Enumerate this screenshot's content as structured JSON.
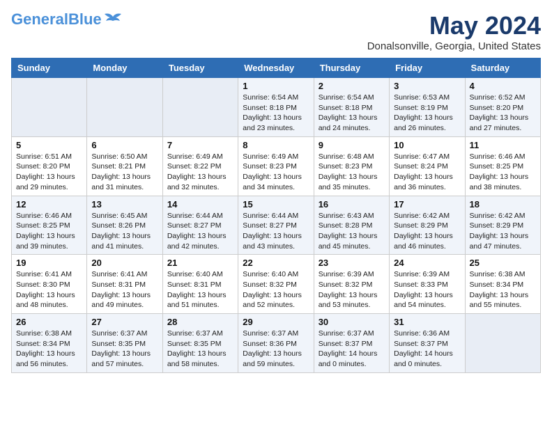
{
  "header": {
    "logo_line1": "General",
    "logo_line2": "Blue",
    "month": "May 2024",
    "location": "Donalsonville, Georgia, United States"
  },
  "weekdays": [
    "Sunday",
    "Monday",
    "Tuesday",
    "Wednesday",
    "Thursday",
    "Friday",
    "Saturday"
  ],
  "weeks": [
    [
      {
        "day": "",
        "info": ""
      },
      {
        "day": "",
        "info": ""
      },
      {
        "day": "",
        "info": ""
      },
      {
        "day": "1",
        "info": "Sunrise: 6:54 AM\nSunset: 8:18 PM\nDaylight: 13 hours\nand 23 minutes."
      },
      {
        "day": "2",
        "info": "Sunrise: 6:54 AM\nSunset: 8:18 PM\nDaylight: 13 hours\nand 24 minutes."
      },
      {
        "day": "3",
        "info": "Sunrise: 6:53 AM\nSunset: 8:19 PM\nDaylight: 13 hours\nand 26 minutes."
      },
      {
        "day": "4",
        "info": "Sunrise: 6:52 AM\nSunset: 8:20 PM\nDaylight: 13 hours\nand 27 minutes."
      }
    ],
    [
      {
        "day": "5",
        "info": "Sunrise: 6:51 AM\nSunset: 8:20 PM\nDaylight: 13 hours\nand 29 minutes."
      },
      {
        "day": "6",
        "info": "Sunrise: 6:50 AM\nSunset: 8:21 PM\nDaylight: 13 hours\nand 31 minutes."
      },
      {
        "day": "7",
        "info": "Sunrise: 6:49 AM\nSunset: 8:22 PM\nDaylight: 13 hours\nand 32 minutes."
      },
      {
        "day": "8",
        "info": "Sunrise: 6:49 AM\nSunset: 8:23 PM\nDaylight: 13 hours\nand 34 minutes."
      },
      {
        "day": "9",
        "info": "Sunrise: 6:48 AM\nSunset: 8:23 PM\nDaylight: 13 hours\nand 35 minutes."
      },
      {
        "day": "10",
        "info": "Sunrise: 6:47 AM\nSunset: 8:24 PM\nDaylight: 13 hours\nand 36 minutes."
      },
      {
        "day": "11",
        "info": "Sunrise: 6:46 AM\nSunset: 8:25 PM\nDaylight: 13 hours\nand 38 minutes."
      }
    ],
    [
      {
        "day": "12",
        "info": "Sunrise: 6:46 AM\nSunset: 8:25 PM\nDaylight: 13 hours\nand 39 minutes."
      },
      {
        "day": "13",
        "info": "Sunrise: 6:45 AM\nSunset: 8:26 PM\nDaylight: 13 hours\nand 41 minutes."
      },
      {
        "day": "14",
        "info": "Sunrise: 6:44 AM\nSunset: 8:27 PM\nDaylight: 13 hours\nand 42 minutes."
      },
      {
        "day": "15",
        "info": "Sunrise: 6:44 AM\nSunset: 8:27 PM\nDaylight: 13 hours\nand 43 minutes."
      },
      {
        "day": "16",
        "info": "Sunrise: 6:43 AM\nSunset: 8:28 PM\nDaylight: 13 hours\nand 45 minutes."
      },
      {
        "day": "17",
        "info": "Sunrise: 6:42 AM\nSunset: 8:29 PM\nDaylight: 13 hours\nand 46 minutes."
      },
      {
        "day": "18",
        "info": "Sunrise: 6:42 AM\nSunset: 8:29 PM\nDaylight: 13 hours\nand 47 minutes."
      }
    ],
    [
      {
        "day": "19",
        "info": "Sunrise: 6:41 AM\nSunset: 8:30 PM\nDaylight: 13 hours\nand 48 minutes."
      },
      {
        "day": "20",
        "info": "Sunrise: 6:41 AM\nSunset: 8:31 PM\nDaylight: 13 hours\nand 49 minutes."
      },
      {
        "day": "21",
        "info": "Sunrise: 6:40 AM\nSunset: 8:31 PM\nDaylight: 13 hours\nand 51 minutes."
      },
      {
        "day": "22",
        "info": "Sunrise: 6:40 AM\nSunset: 8:32 PM\nDaylight: 13 hours\nand 52 minutes."
      },
      {
        "day": "23",
        "info": "Sunrise: 6:39 AM\nSunset: 8:32 PM\nDaylight: 13 hours\nand 53 minutes."
      },
      {
        "day": "24",
        "info": "Sunrise: 6:39 AM\nSunset: 8:33 PM\nDaylight: 13 hours\nand 54 minutes."
      },
      {
        "day": "25",
        "info": "Sunrise: 6:38 AM\nSunset: 8:34 PM\nDaylight: 13 hours\nand 55 minutes."
      }
    ],
    [
      {
        "day": "26",
        "info": "Sunrise: 6:38 AM\nSunset: 8:34 PM\nDaylight: 13 hours\nand 56 minutes."
      },
      {
        "day": "27",
        "info": "Sunrise: 6:37 AM\nSunset: 8:35 PM\nDaylight: 13 hours\nand 57 minutes."
      },
      {
        "day": "28",
        "info": "Sunrise: 6:37 AM\nSunset: 8:35 PM\nDaylight: 13 hours\nand 58 minutes."
      },
      {
        "day": "29",
        "info": "Sunrise: 6:37 AM\nSunset: 8:36 PM\nDaylight: 13 hours\nand 59 minutes."
      },
      {
        "day": "30",
        "info": "Sunrise: 6:37 AM\nSunset: 8:37 PM\nDaylight: 14 hours\nand 0 minutes."
      },
      {
        "day": "31",
        "info": "Sunrise: 6:36 AM\nSunset: 8:37 PM\nDaylight: 14 hours\nand 0 minutes."
      },
      {
        "day": "",
        "info": ""
      }
    ]
  ]
}
